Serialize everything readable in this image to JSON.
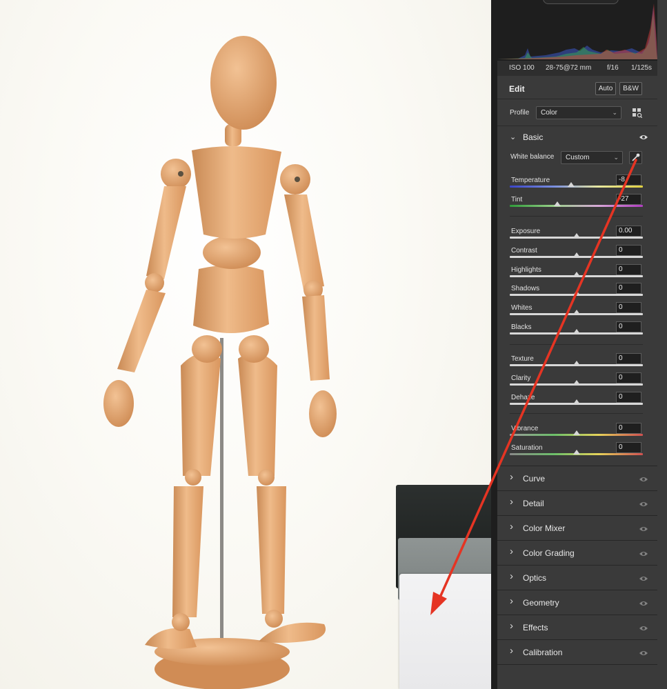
{
  "exif": {
    "iso": "ISO 100",
    "lens": "28-75@72 mm",
    "aperture": "f/16",
    "shutter": "1/125s"
  },
  "edit": {
    "title": "Edit",
    "auto_label": "Auto",
    "bw_label": "B&W"
  },
  "profile": {
    "label": "Profile",
    "value": "Color"
  },
  "basic": {
    "title": "Basic",
    "white_balance": {
      "label": "White balance",
      "value": "Custom"
    },
    "sliders": [
      {
        "label": "Temperature",
        "value": "-8",
        "level": 0.46
      },
      {
        "label": "Tint",
        "value": "-27",
        "level": 0.36
      },
      {
        "label": "Exposure",
        "value": "0.00",
        "level": 0.5
      },
      {
        "label": "Contrast",
        "value": "0",
        "level": 0.5
      },
      {
        "label": "Highlights",
        "value": "0",
        "level": 0.5
      },
      {
        "label": "Shadows",
        "value": "0",
        "level": 0.5
      },
      {
        "label": "Whites",
        "value": "0",
        "level": 0.5
      },
      {
        "label": "Blacks",
        "value": "0",
        "level": 0.5
      },
      {
        "label": "Texture",
        "value": "0",
        "level": 0.5
      },
      {
        "label": "Clarity",
        "value": "0",
        "level": 0.5
      },
      {
        "label": "Dehaze",
        "value": "0",
        "level": 0.5
      },
      {
        "label": "Vibrance",
        "value": "0",
        "level": 0.5
      },
      {
        "label": "Saturation",
        "value": "0",
        "level": 0.5
      }
    ]
  },
  "sections": [
    "Curve",
    "Detail",
    "Color Mixer",
    "Color Grading",
    "Optics",
    "Geometry",
    "Effects",
    "Calibration"
  ],
  "colors": {
    "panel": "#3a3a3a",
    "annotation_arrow": "#e53423"
  }
}
